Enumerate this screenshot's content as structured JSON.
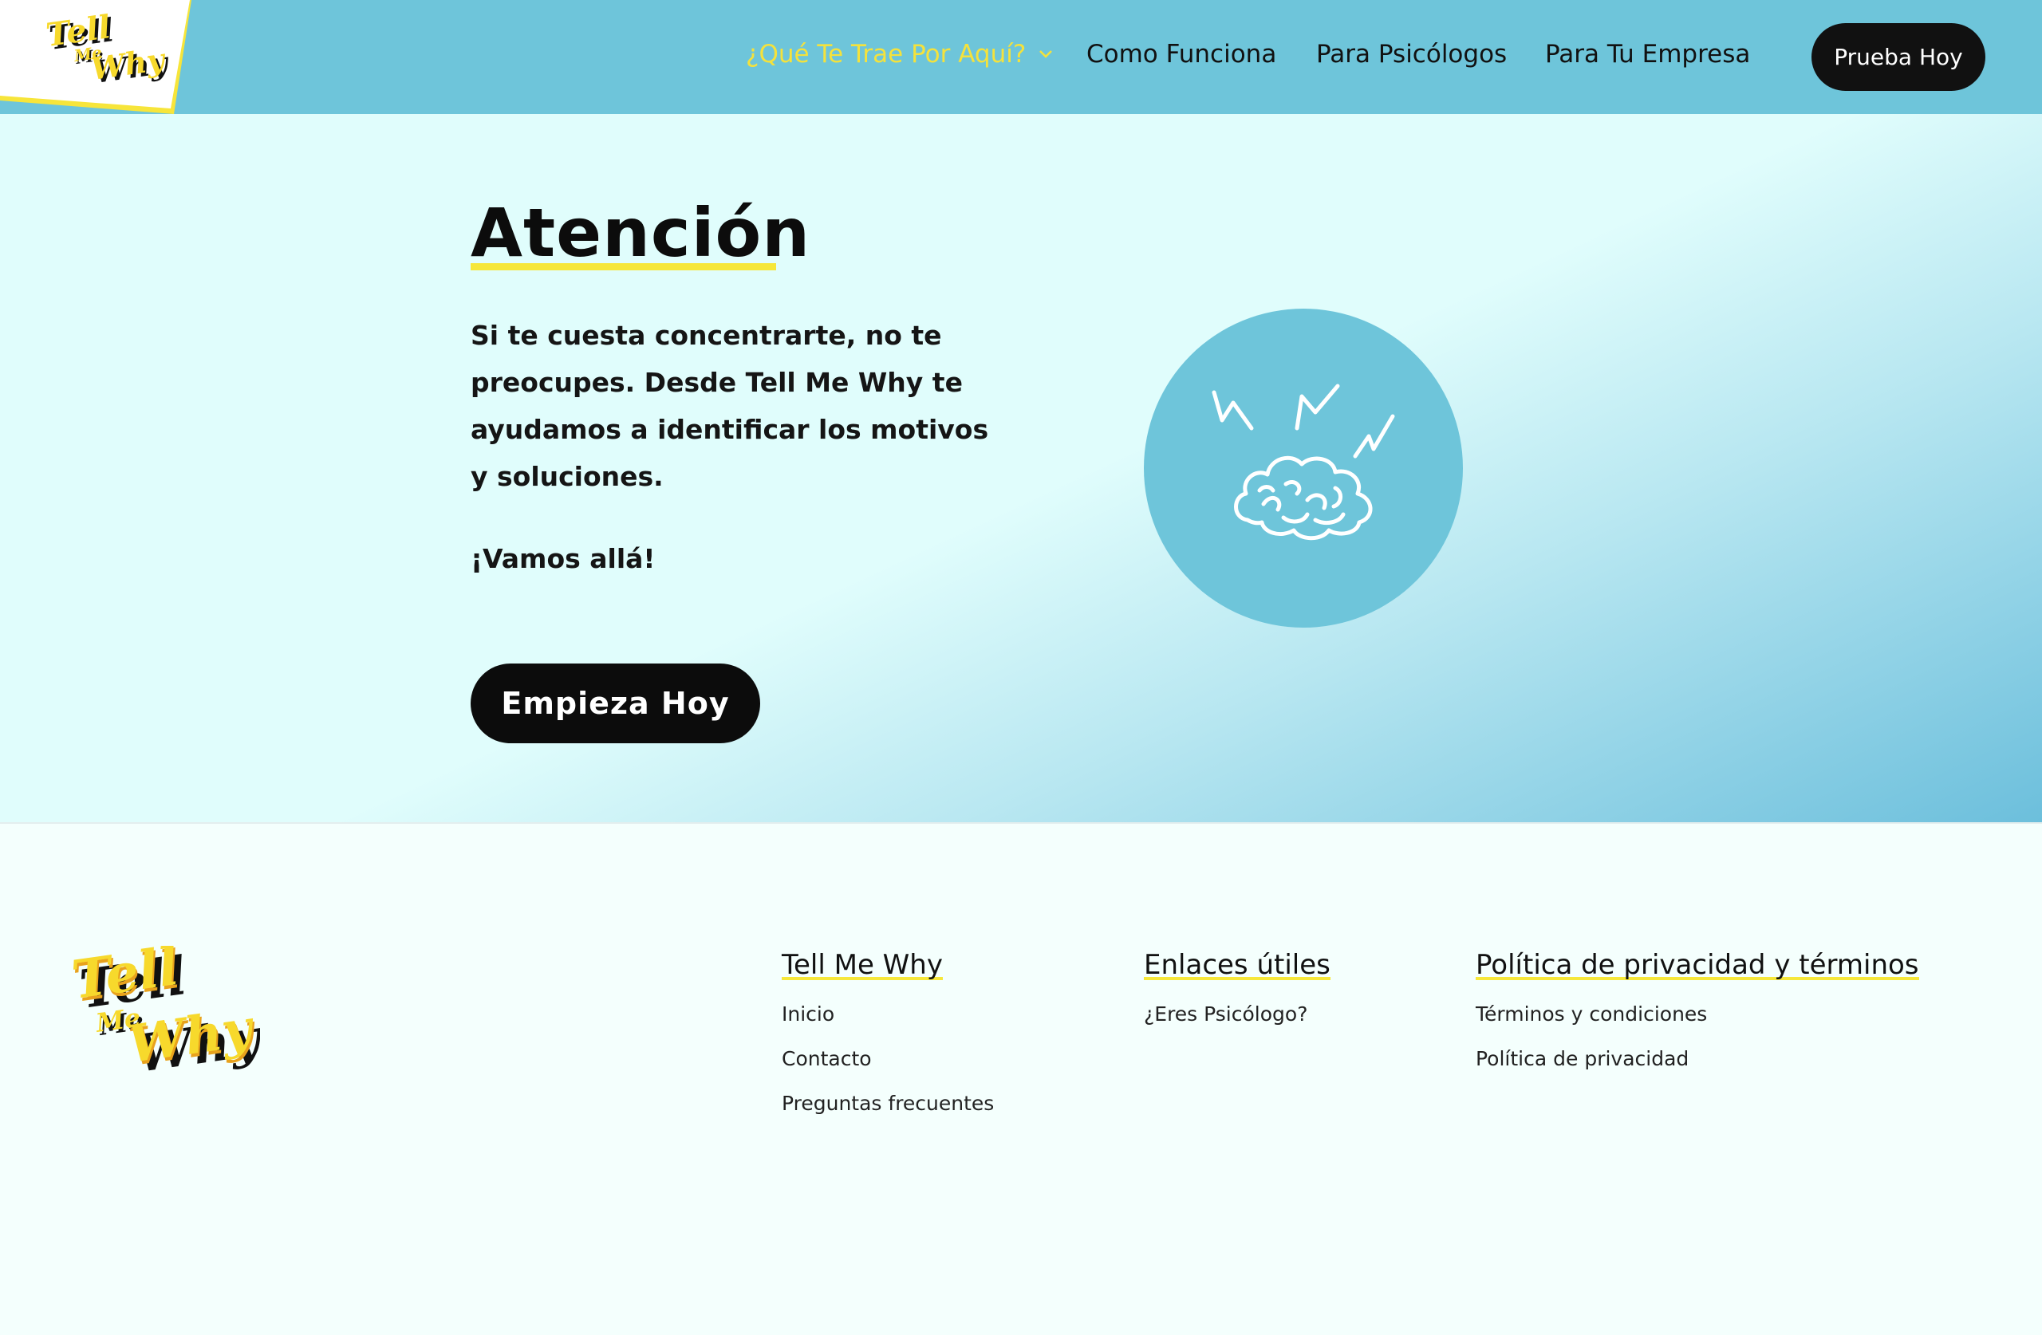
{
  "brand": {
    "name": "Tell Me Why"
  },
  "header": {
    "nav": [
      {
        "label": "¿Qué Te Trae Por Aquí?",
        "active": true,
        "dropdown": true
      },
      {
        "label": "Como Funciona"
      },
      {
        "label": "Para Psicólogos"
      },
      {
        "label": "Para Tu Empresa"
      }
    ],
    "cta_label": "Prueba Hoy"
  },
  "hero": {
    "title": "Atención",
    "text": "Si te cuesta concentrarte, no te preocupes. Desde Tell Me Why te ayudamos a identificar los motivos y soluciones.",
    "cta_line": "¡Vamos allá!",
    "cta_label": "Empieza Hoy",
    "illustration_icon": "brain-lightning-icon"
  },
  "footer": {
    "columns": [
      {
        "title": "Tell Me Why",
        "links": [
          "Inicio",
          "Contacto",
          "Preguntas frecuentes"
        ]
      },
      {
        "title": "Enlaces útiles",
        "links": [
          "¿Eres Psicólogo?"
        ]
      },
      {
        "title": "Política de privacidad y términos",
        "links": [
          "Términos y condiciones",
          "Política de privacidad"
        ]
      }
    ]
  },
  "colors": {
    "header_bg": "#6ec5da",
    "accent_yellow": "#f6e73a",
    "button_dark": "#0c0c0c",
    "hero_light": "#e0fdfc"
  }
}
